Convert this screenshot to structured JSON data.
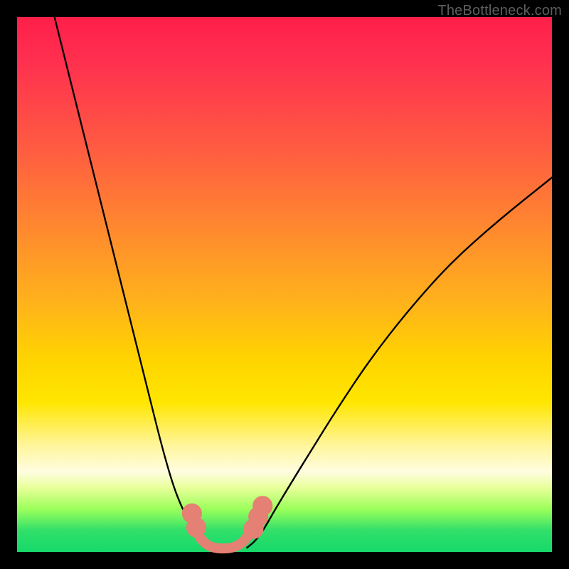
{
  "watermark": "TheBottleneck.com",
  "chart_data": {
    "type": "line",
    "title": "",
    "xlabel": "",
    "ylabel": "",
    "xlim": [
      0,
      100
    ],
    "ylim": [
      0,
      100
    ],
    "grid": false,
    "legend": false,
    "gradient_stops": [
      {
        "pos": 0,
        "color": "#ff1f4a"
      },
      {
        "pos": 24,
        "color": "#ff5a42"
      },
      {
        "pos": 40,
        "color": "#ff8a2e"
      },
      {
        "pos": 64,
        "color": "#ffd400"
      },
      {
        "pos": 85,
        "color": "#fffde0"
      },
      {
        "pos": 96,
        "color": "#31e06a"
      },
      {
        "pos": 100,
        "color": "#16d96a"
      }
    ],
    "series": [
      {
        "name": "left-curve",
        "stroke": "#000000",
        "x": [
          7,
          10,
          14,
          18,
          22,
          25,
          27,
          29,
          30.5,
          32,
          33.5,
          35,
          36
        ],
        "y": [
          100,
          88,
          72,
          56,
          40,
          28,
          20,
          13,
          9,
          6,
          3.5,
          1.8,
          0.8
        ]
      },
      {
        "name": "right-curve",
        "stroke": "#000000",
        "x": [
          43,
          44.5,
          46,
          48,
          51,
          55,
          60,
          66,
          73,
          81,
          90,
          100
        ],
        "y": [
          0.8,
          2,
          4,
          7.5,
          12.5,
          19,
          27,
          36,
          45,
          54,
          62,
          70
        ]
      },
      {
        "name": "salmon-bottom-arc",
        "stroke": "#e58074",
        "x": [
          32.5,
          33.5,
          34.8,
          36.5,
          38.5,
          40.5,
          42.3,
          43.7,
          44.8,
          45.8
        ],
        "y": [
          6.5,
          3.8,
          1.8,
          0.8,
          0.6,
          0.8,
          1.8,
          3.8,
          6.0,
          8.2
        ]
      }
    ],
    "markers": [
      {
        "series": "salmon-bottom-arc",
        "x": 32.7,
        "y": 7.2,
        "r": 1.2,
        "color": "#e58074"
      },
      {
        "series": "salmon-bottom-arc",
        "x": 33.5,
        "y": 4.6,
        "r": 1.2,
        "color": "#e58074"
      },
      {
        "series": "salmon-bottom-arc",
        "x": 44.2,
        "y": 4.3,
        "r": 1.2,
        "color": "#e58074"
      },
      {
        "series": "salmon-bottom-arc",
        "x": 45.1,
        "y": 6.6,
        "r": 1.2,
        "color": "#e58074"
      },
      {
        "series": "salmon-bottom-arc",
        "x": 45.9,
        "y": 8.6,
        "r": 1.2,
        "color": "#e58074"
      }
    ]
  }
}
